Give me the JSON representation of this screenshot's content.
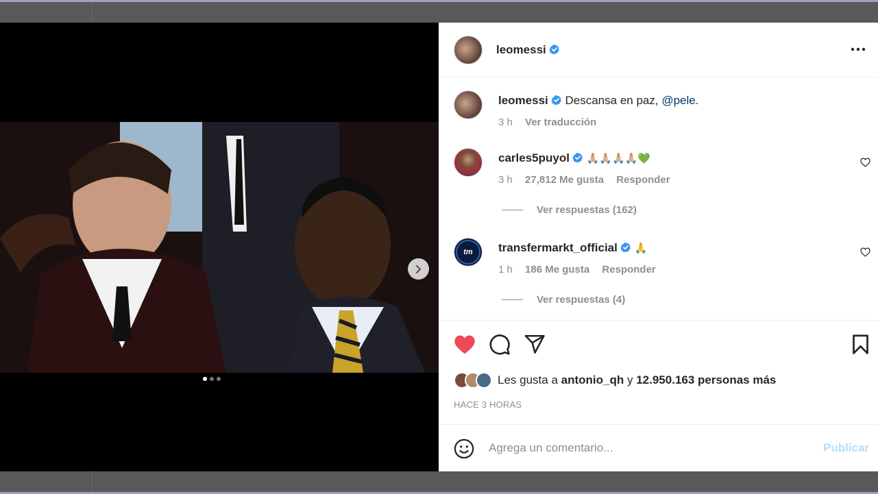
{
  "post": {
    "username": "leomessi",
    "more_icon": "more-horizontal-icon"
  },
  "caption": {
    "username": "leomessi",
    "text": "Descansa en paz,",
    "mention": "@pele",
    "trailing": ".",
    "time": "3 h",
    "translate": "Ver traducción"
  },
  "comments": [
    {
      "username": "carles5puyol",
      "text": "🙏🏼🙏🏼🙏🏼🙏🏼💚",
      "time": "3 h",
      "likes": "27,812 Me gusta",
      "reply": "Responder",
      "view_replies": "Ver respuestas (162)"
    },
    {
      "username": "transfermarkt_official",
      "avatar_text": "tm",
      "text": "🙏",
      "time": "1 h",
      "likes": "186 Me gusta",
      "reply": "Responder",
      "view_replies": "Ver respuestas (4)"
    }
  ],
  "likes": {
    "prefix": "Les gusta a",
    "user": "antonio_qh",
    "connector": "y",
    "count_text": "12.950.163 personas más"
  },
  "timestamp": "HACE 3 HORAS",
  "add_comment": {
    "placeholder": "Agrega un comentario...",
    "publish": "Publicar"
  },
  "colors": {
    "accent_blue": "#0095f6",
    "verified": "#3897f0",
    "like_red": "#ed4956",
    "publish_disabled": "#b2dffc"
  },
  "carousel": {
    "current": 1,
    "total": 3
  }
}
